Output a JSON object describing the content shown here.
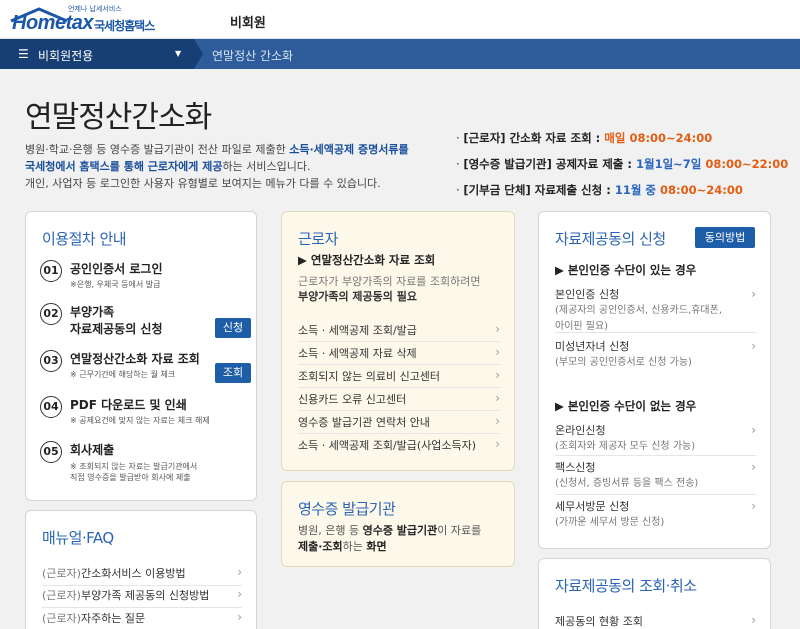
{
  "header": {
    "logo_tagline": "언제나 납세서비스",
    "logo_en": "Hometax",
    "logo_ko": "국세청홈택스",
    "member_label": "비회원"
  },
  "nav": {
    "menu_label": "비회원전용",
    "breadcrumb": "연말정산 간소화"
  },
  "page": {
    "title": "연말정산간소화",
    "intro_1": "병원·학교·은행 등 영수증 발급기관이 전산 파일로 제출한 ",
    "intro_bold_1": "소득·세액공제 증명서류를",
    "intro_bold_2": "국세청에서 홈택스를 통해 근로자에게 제공",
    "intro_2": "하는 서비스입니다.",
    "intro_3": "개인, 사업자 등 로그인한 사용자 유형별로 보여지는 메뉴가 다를 수 있습니다."
  },
  "schedule": [
    {
      "key": "[근로자]",
      "label": " 간소화 자료 조회 : ",
      "when": "매일",
      "time": " 08:00~24:00"
    },
    {
      "key": "[영수증 발급기관]",
      "label": " 공제자료 제출 : ",
      "when": "1월1일~7일",
      "time": " 08:00~22:00"
    },
    {
      "key": "[기부금 단체]",
      "label": " 자료제출 신청 : ",
      "when": "11월 중",
      "time": " 08:00~24:00"
    }
  ],
  "procedure": {
    "title": "이용절차 안내",
    "steps": [
      {
        "num": "01",
        "title": "공인인증서 로그인",
        "sub": "※은행, 우체국 등에서 발급"
      },
      {
        "num": "02",
        "title": "부양가족",
        "title2": "자료제공동의 신청",
        "button": "신청"
      },
      {
        "num": "03",
        "title": "연말정산간소화 자료 조회",
        "sub": "※ 근무기간에 해당하는 월 체크",
        "button": "조회"
      },
      {
        "num": "04",
        "title": "PDF 다운로드 및 인쇄",
        "sub": "※ 공제요건에 맞지 않는 자료는 체크 해제"
      },
      {
        "num": "05",
        "title": "회사제출",
        "sub": "※ 조회되지 않는 자료는 발급기관에서",
        "sub2": "직접 영수증을 발급받아 회사에 제출"
      }
    ]
  },
  "manual": {
    "title": "매뉴얼·FAQ",
    "items": [
      {
        "prefix": "(근로자)",
        "label": "간소화서비스 이용방법"
      },
      {
        "prefix": "(근로자)",
        "label": "부양가족 제공동의 신청방법"
      },
      {
        "prefix": "(근로자)",
        "label": "자주하는 질문"
      }
    ]
  },
  "worker": {
    "title": "근로자",
    "subhead": "▶ 연말정산간소화 자료 조회",
    "desc_1": "근로자가 부양가족의 자료를 조회하려면",
    "desc_bold": "부양가족의 제공동의 필요",
    "links": [
      "소득 · 세액공제 조회/발급",
      "소득 · 세액공제 자료 삭제",
      "조회되지 않는 의료비 신고센터",
      "신용카드 오류 신고센터",
      "영수증 발급기관 연락처 안내",
      "소득 · 세액공제 조회/발급(사업소득자)"
    ]
  },
  "issuer": {
    "title": "영수증 발급기관",
    "desc_1": "병원, 은행 등 ",
    "desc_bold_1": "영수증 발급기관",
    "desc_2": "이 자료를",
    "desc_bold_2": "제출·조회",
    "desc_3": "하는 ",
    "desc_bold_3": "화면"
  },
  "consent": {
    "title": "자료제공동의 신청",
    "button": "동의방법",
    "section_1": "▶ 본인인증 수단이 있는 경우",
    "items_1": [
      {
        "label": "본인인증 신청",
        "desc": "(제공자의 공인인증서, 신용카드,휴대폰,",
        "desc2": "아이핀 필요)"
      },
      {
        "label": "미성년자녀 신청",
        "desc": "(부모의 공인인증서로 신청 가능)"
      }
    ],
    "section_2": "▶ 본인인증 수단이 없는 경우",
    "items_2": [
      {
        "label": "온라인신청",
        "desc": "(조회자와 제공자 모두 신청 가능)"
      },
      {
        "label": "팩스신청",
        "desc": "(신청서, 증빙서류 등을 팩스 전송)"
      },
      {
        "label": "세무서방문 신청",
        "desc": "(가까운 세무서 방문 신청)"
      }
    ]
  },
  "lookup": {
    "title": "자료제공동의 조회·취소",
    "items": [
      "제공동의 현황 조회"
    ]
  },
  "colors": {
    "brand_blue": "#1b57a8",
    "nav_blue": "#2e5c9b",
    "accent_orange": "#e35d12"
  }
}
